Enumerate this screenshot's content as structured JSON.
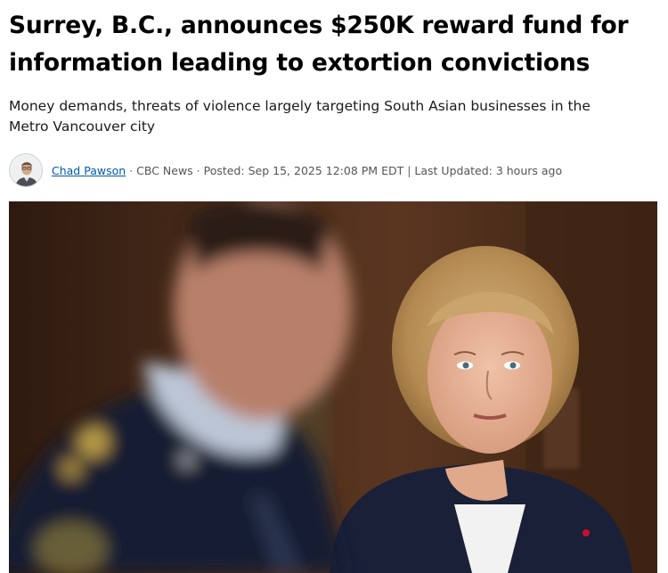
{
  "article": {
    "headline_line1": "Surrey, B.C., announces $250K reward fund for",
    "headline_line2": "information leading to extortion convictions",
    "deck_line1": "Money demands, threats of violence largely targeting South Asian businesses in the",
    "deck_line2": "Metro Vancouver city"
  },
  "byline": {
    "author": "Chad Pawson",
    "sep1": "·",
    "outlet": "CBC News",
    "sep2": "·",
    "posted": "Posted: Sep 15, 2025 12:08 PM EDT",
    "sep3": "|",
    "updated": "Last Updated: 3 hours ago"
  },
  "photo": {
    "description_icon": "news-photo"
  },
  "colors": {
    "link": "#0059a8",
    "meta": "#555555"
  }
}
